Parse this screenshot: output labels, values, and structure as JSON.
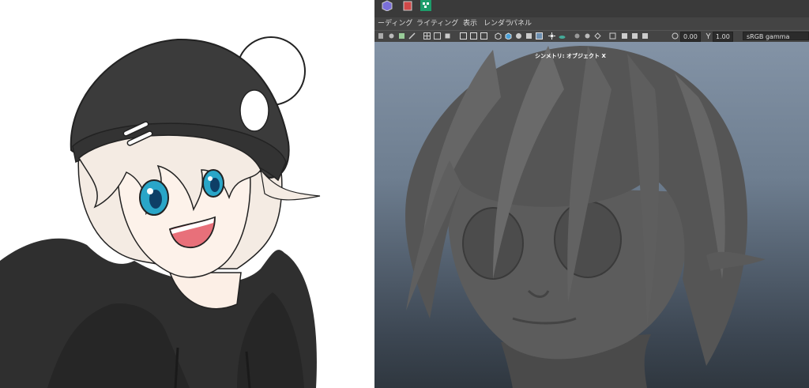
{
  "maya": {
    "menu": [
      "ーディング",
      "ライティング",
      "表示",
      "レンダラ",
      "パネル"
    ],
    "exposure_value": "0.00",
    "gamma_value": "1.00",
    "color_space": "sRGB gamma",
    "camera_label": "シンメトリ: オブジェクト X"
  },
  "colors": {
    "ui_bg": "#444444",
    "viewport_top": "#8393a6",
    "viewport_bottom": "#2f373f",
    "hoodie": "#2f2f2f",
    "hair_light": "#f4ebe3",
    "eye": "#2aa6c8",
    "mouth": "#e8707a"
  },
  "icons": [
    "cube-icon",
    "cylinder-icon",
    "checker-icon",
    "camera-icon",
    "grid-icon",
    "wireframe-icon",
    "shaded-icon",
    "light-icon",
    "exposure-icon"
  ]
}
